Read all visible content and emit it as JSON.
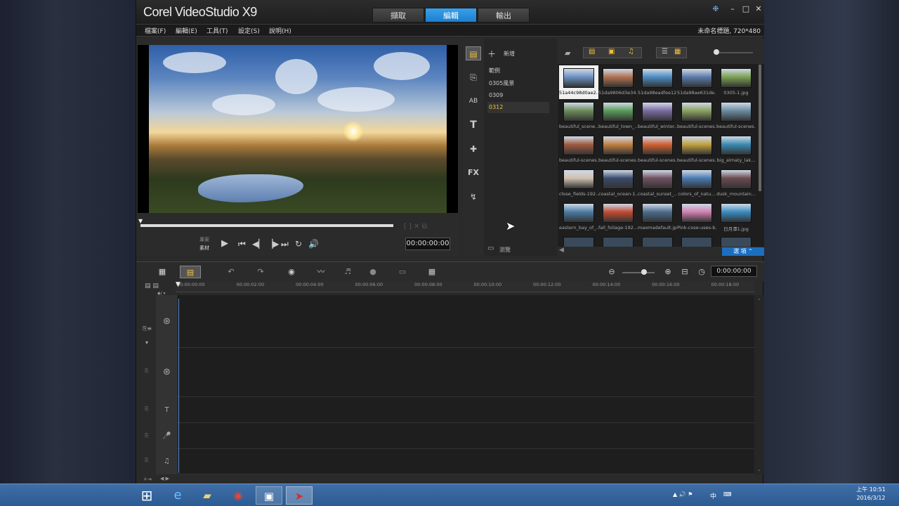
{
  "app": {
    "logo": "Corel VideoStudio X9",
    "project": "未命名標題, 720*480"
  },
  "modes": [
    {
      "label": "擷取"
    },
    {
      "label": "編輯"
    },
    {
      "label": "輸出"
    }
  ],
  "menu": [
    "檔案(F)",
    "編輯(E)",
    "工具(T)",
    "設定(S)",
    "說明(H)"
  ],
  "player": {
    "timecode": "00:00:00:00",
    "mode_project": "專案",
    "mode_clip": "素材"
  },
  "library": {
    "add_label": "新增",
    "browse_label": "瀏覽",
    "options_label": "選 項",
    "folders": [
      "範例",
      "0305風景",
      "0309",
      "0312"
    ],
    "thumbnails": [
      {
        "caption": "51a44c98d0ae2...",
        "color": "#6b8fc0"
      },
      {
        "caption": "51da9806d3e34...",
        "color": "#b07050"
      },
      {
        "caption": "51da98eadfee12...",
        "color": "#4a8ac0"
      },
      {
        "caption": "51da98ae631de...",
        "color": "#5a7aa8"
      },
      {
        "caption": "0305-1.jpg",
        "color": "#7aa050"
      },
      {
        "caption": "beautiful_scene...",
        "color": "#6a8a5a"
      },
      {
        "caption": "beautiful_town_...",
        "color": "#5a9a5a"
      },
      {
        "caption": "beautiful_winter...",
        "color": "#7a6aa0"
      },
      {
        "caption": "beautiful-scenes...",
        "color": "#8aa060"
      },
      {
        "caption": "beautiful-scenes...",
        "color": "#6a8aa0"
      },
      {
        "caption": "beautiful-scenes...",
        "color": "#a05a40"
      },
      {
        "caption": "beautiful-scenes...",
        "color": "#c08040"
      },
      {
        "caption": "beautiful-scenes...",
        "color": "#d06030"
      },
      {
        "caption": "beautiful-scenes...",
        "color": "#c0a040"
      },
      {
        "caption": "big_almaty_lak...",
        "color": "#3a8ab0"
      },
      {
        "caption": "close_fields-192...",
        "color": "#d0c0b0"
      },
      {
        "caption": "coastal_ocean-1...",
        "color": "#3a4a6a"
      },
      {
        "caption": "coastal_sunset_...",
        "color": "#705060"
      },
      {
        "caption": "colors_of_natu...",
        "color": "#4a7ab0"
      },
      {
        "caption": "dusk_mountain...",
        "color": "#6a4a50"
      },
      {
        "caption": "eastern_bay_of_...",
        "color": "#4a7aa0"
      },
      {
        "caption": "fall_foliage-192...",
        "color": "#c04a30"
      },
      {
        "caption": "maomadefault.jpg",
        "color": "#4a6a8a"
      },
      {
        "caption": "Pink-cose-uses-b...",
        "color": "#d080b0"
      },
      {
        "caption": "日月潭1.jpg",
        "color": "#3a8ac0"
      }
    ]
  },
  "timeline": {
    "clock": "0:00:00:00",
    "ticks": [
      "00:00:00:00",
      "00:00:02:00",
      "00:00:04:00",
      "00:00:06:00",
      "00:00:08:00",
      "00:00:10:00",
      "00:00:12:00",
      "00:00:14:00",
      "00:00:16:00",
      "00:00:18:00"
    ]
  },
  "taskbar": {
    "time": "上午 10:51",
    "date": "2016/3/12",
    "ime": "中"
  }
}
